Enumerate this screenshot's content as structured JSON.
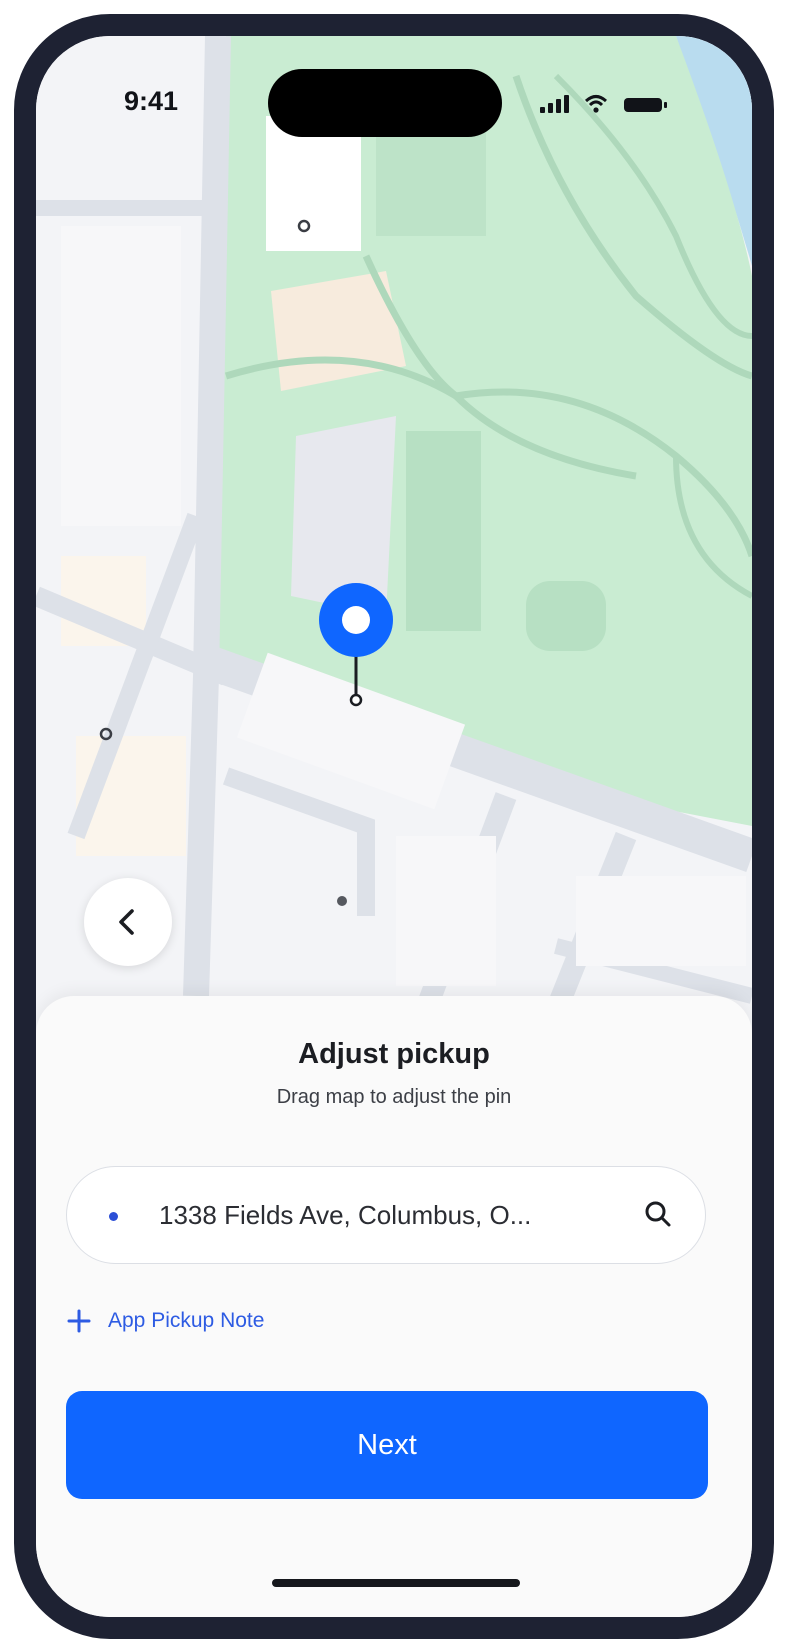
{
  "status_bar": {
    "time": "9:41"
  },
  "map": {
    "pin_color": "#0f66ff",
    "park_color": "#c9ecd2",
    "road_color": "#dde1e8"
  },
  "back_button": {
    "icon": "chevron-left-icon"
  },
  "sheet": {
    "title": "Adjust pickup",
    "subtitle": "Drag map to adjust the pin",
    "address": "1338 Fields Ave, Columbus, O...",
    "search_icon": "search-icon",
    "add_note_label": "App Pickup Note",
    "next_label": "Next",
    "accent_color": "#0f66ff"
  }
}
